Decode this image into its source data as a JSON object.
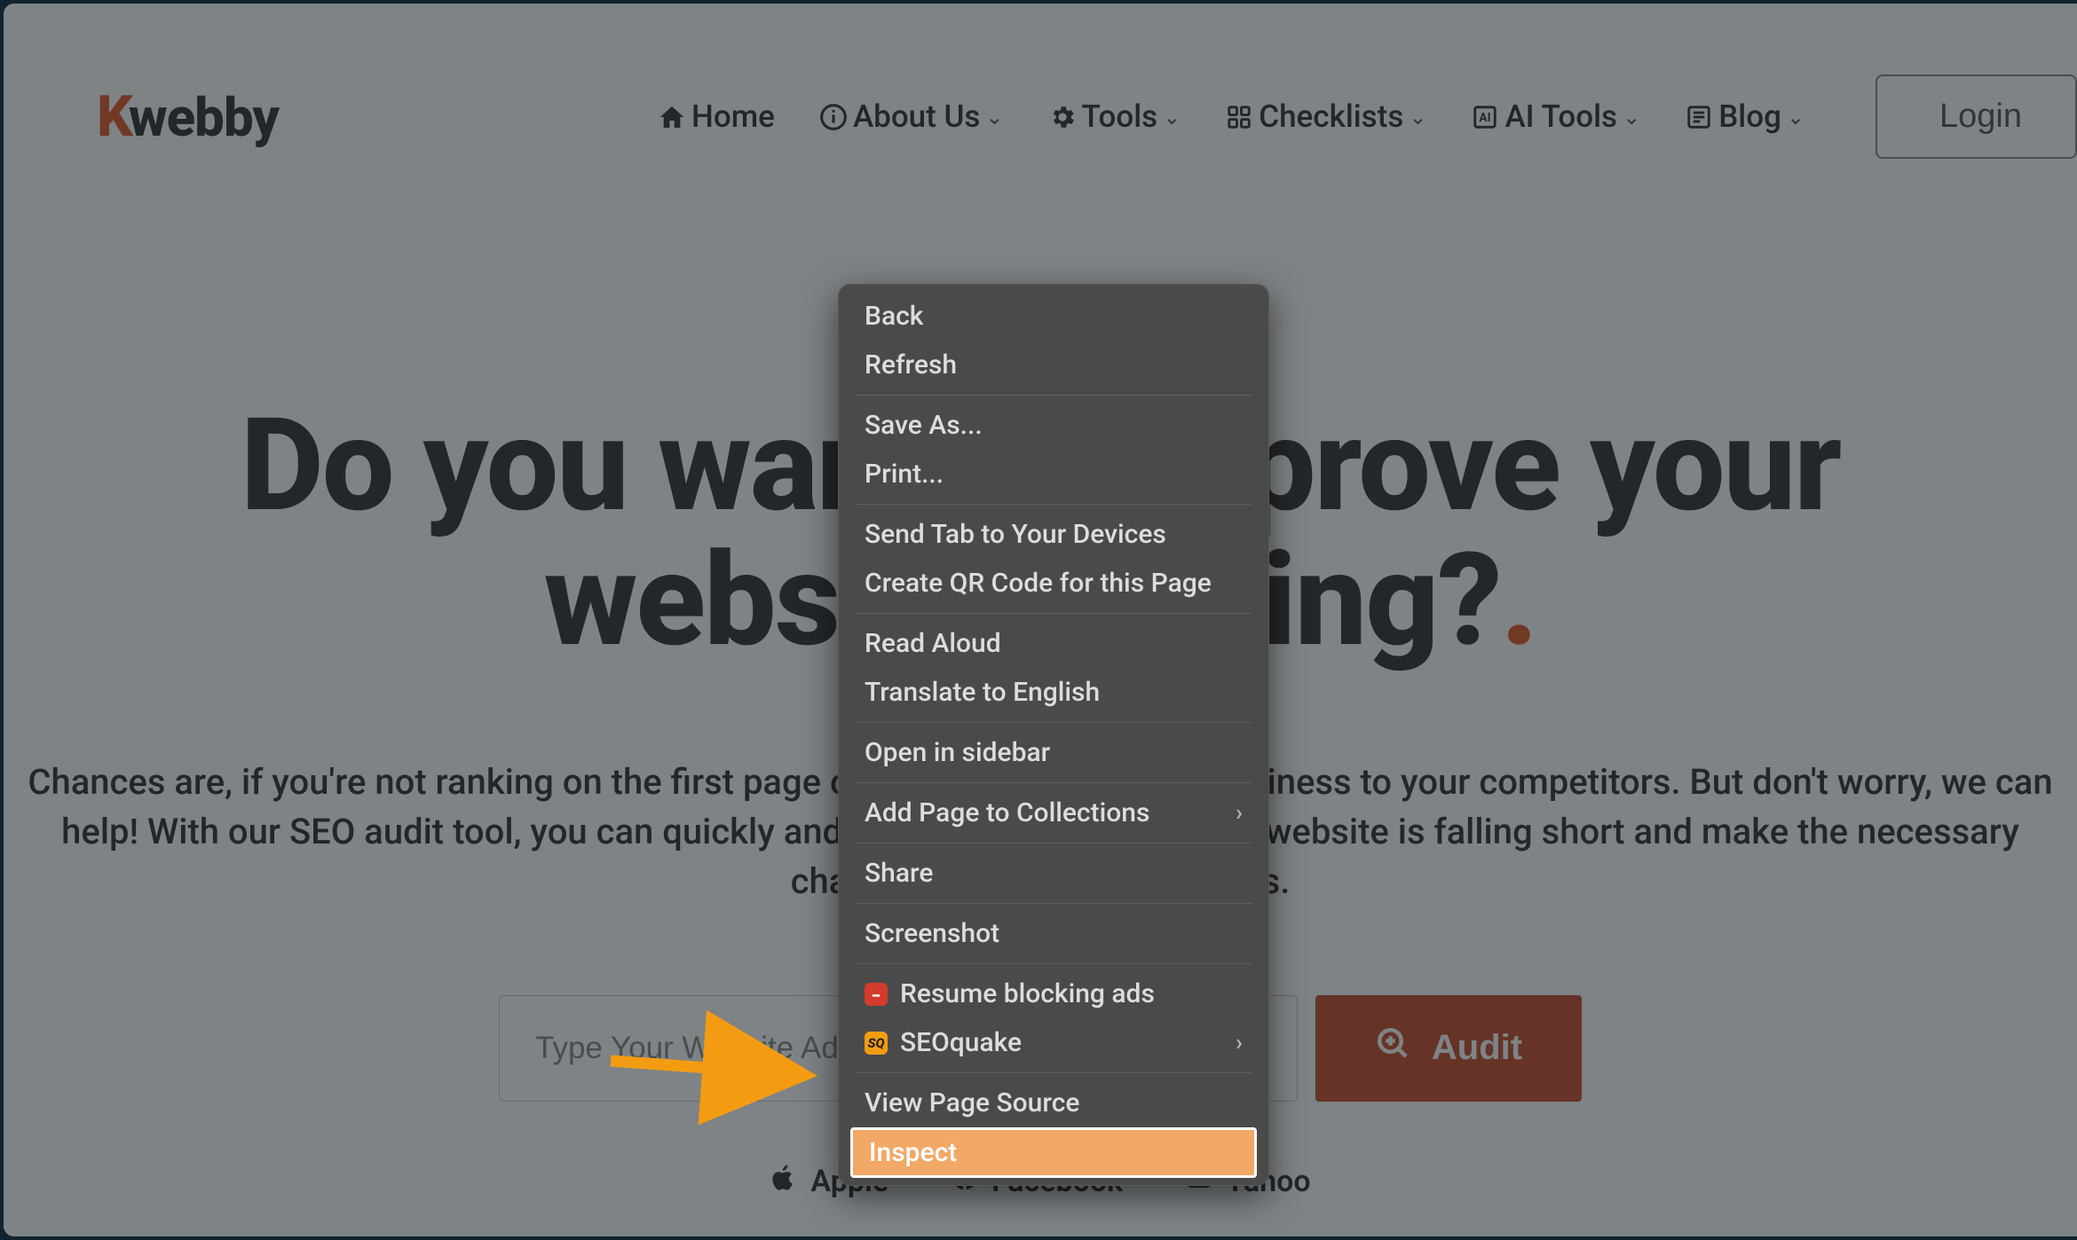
{
  "logo": {
    "k": "K",
    "rest": "webby"
  },
  "nav": {
    "home": "Home",
    "about": "About Us",
    "tools": "Tools",
    "checklists": "Checklists",
    "ai_tools": "AI Tools",
    "blog": "Blog",
    "login": "Login"
  },
  "hero": {
    "title_line1": "Do you want to improve your",
    "title_line2": "website ranking?",
    "dot": ".",
    "sub_line1": "Chances are, if you're not ranking on the first page of Google, you're losing business to your competitors. But don't worry, we can",
    "sub_line2": "help! With our SEO audit tool, you can quickly and easily find out where your website is falling short and make the necessary",
    "sub_line3": "changes to start seeing results."
  },
  "search": {
    "placeholder": "Type Your Website Address",
    "audit_label": "Audit"
  },
  "brands": {
    "apple": "Apple",
    "facebook": "Facebook",
    "yahoo": "Yahoo"
  },
  "context_menu": {
    "back": "Back",
    "refresh": "Refresh",
    "save_as": "Save As...",
    "print": "Print...",
    "send_tab": "Send Tab to Your Devices",
    "create_qr": "Create QR Code for this Page",
    "read_aloud": "Read Aloud",
    "translate": "Translate to English",
    "open_sidebar": "Open in sidebar",
    "add_collections": "Add Page to Collections",
    "share": "Share",
    "screenshot": "Screenshot",
    "resume_ads": "Resume blocking ads",
    "seoquake": "SEOquake",
    "view_source": "View Page Source",
    "inspect": "Inspect",
    "seo_icon": "SQ"
  }
}
